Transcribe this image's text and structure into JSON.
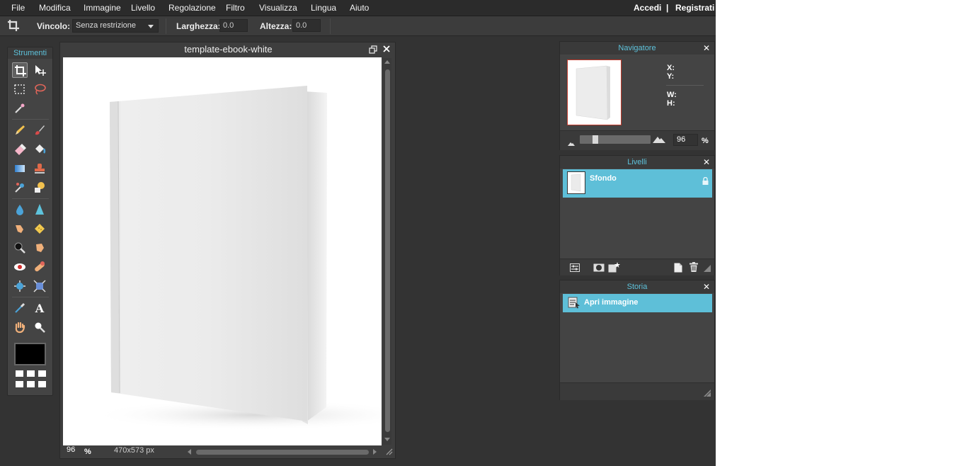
{
  "menubar": {
    "items": [
      "File",
      "Modifica",
      "Immagine",
      "Livello",
      "Regolazione",
      "Filtro",
      "Visualizza",
      "Lingua",
      "Aiuto"
    ],
    "login": "Accedi",
    "separator": "|",
    "register": "Registrati"
  },
  "optionsbar": {
    "constraint_label": "Vincolo:",
    "constraint_value": "Senza restrizione",
    "width_label": "Larghezza:",
    "width_value": "0.0",
    "height_label": "Altezza:",
    "height_value": "0.0"
  },
  "tools": {
    "title": "Strumenti",
    "foreground_color": "#000000"
  },
  "document": {
    "title": "template-ebook-white",
    "zoom": "96",
    "zoom_unit": "%",
    "dimensions": "470x573 px"
  },
  "navigator": {
    "title": "Navigatore",
    "close": "✕",
    "x_label": "X:",
    "y_label": "Y:",
    "w_label": "W:",
    "h_label": "H:",
    "zoom_value": "96",
    "zoom_unit": "%",
    "zoom_level": 0.2
  },
  "layers": {
    "title": "Livelli",
    "close": "✕",
    "items": [
      {
        "name": "Sfondo",
        "locked": true
      }
    ]
  },
  "history": {
    "title": "Storia",
    "close": "✕",
    "items": [
      "Apri immagine"
    ]
  },
  "colors": {
    "accent": "#5ebfd8",
    "app_bg": "#333333",
    "panel_bg": "#444444"
  }
}
